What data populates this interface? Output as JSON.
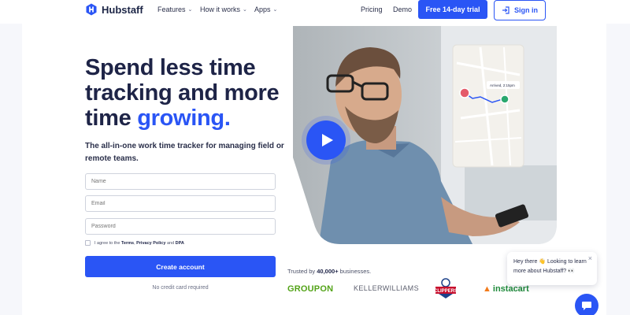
{
  "header": {
    "logo_text": "Hubstaff",
    "nav": [
      {
        "label": "Features",
        "dropdown": true
      },
      {
        "label": "How it works",
        "dropdown": true
      },
      {
        "label": "Apps",
        "dropdown": true
      }
    ],
    "pricing_label": "Pricing",
    "demo_label": "Demo",
    "trial_label": "Free 14-day trial",
    "signin_label": "Sign in"
  },
  "hero": {
    "headline_line1": "Spend less time",
    "headline_line2": "tracking and more",
    "headline_line3_start": "time ",
    "headline_line3_accent": "growing.",
    "subheading": "The all-in-one work time tracker for managing field or remote teams."
  },
  "form": {
    "name_placeholder": "Name",
    "email_placeholder": "Email",
    "password_placeholder": "Password",
    "agree_prefix": "I agree to the ",
    "terms": "Terms",
    "sep": ", ",
    "privacy": "Privacy Policy",
    "and": " and ",
    "dpa": "DPA",
    "create_label": "Create account",
    "no_credit": "No credit card required"
  },
  "map_card": {
    "time_label": "Arrived, 2:15pm"
  },
  "trusted": {
    "prefix": "Trusted by ",
    "count": "40,000+",
    "suffix": " businesses.",
    "brands": [
      "GROUPON",
      "KELLERWILLIAMS",
      "CLIPPERS",
      "instacart"
    ]
  },
  "chat": {
    "message": "Hey there 👋 Looking to learn more about Hubstaff? 👀"
  },
  "colors": {
    "accent": "#2a55f5",
    "heading": "#1e2447",
    "groupon": "#53a318",
    "instacart": "#1f8a3b"
  }
}
